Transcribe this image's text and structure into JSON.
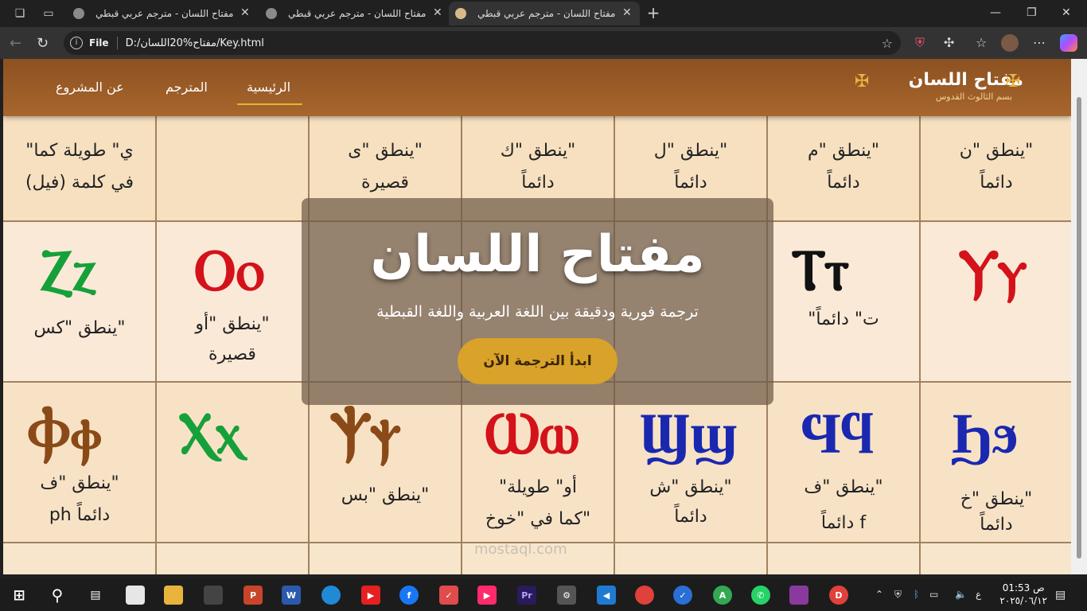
{
  "browser": {
    "tabs": [
      {
        "title": "مفتاح اللسان - مترجم عربي قبطي",
        "active": false
      },
      {
        "title": "مفتاح اللسان - مترجم عربي قبطي",
        "active": false
      },
      {
        "title": "مفتاح اللسان - مترجم عربي قبطي",
        "active": true
      }
    ],
    "new_tab": "+",
    "address": {
      "scheme_label": "File",
      "url": "D:/مفتاح%20اللسان/Key.html"
    }
  },
  "site": {
    "title": "مفتاح اللسان",
    "subtitle": "بسم الثالوث القدوس",
    "nav": {
      "home": "الرئيسية",
      "translator": "المترجم",
      "about": "عن المشروع"
    }
  },
  "hero": {
    "heading": "مفتاح اللسان",
    "tagline": "ترجمة فورية ودقيقة بين اللغة العربية واللغة القبطية",
    "cta": "ابدأ الترجمة الآن"
  },
  "watermark": "mostaql.com",
  "taskbar": {
    "clock_time": "01:53 ص",
    "clock_date": "٢٠٢٥/٠٦/١٢",
    "lang": "ع"
  },
  "colors": {
    "header": "#9b5b26",
    "accent": "#e6b532",
    "cta": "#d9a22a"
  }
}
